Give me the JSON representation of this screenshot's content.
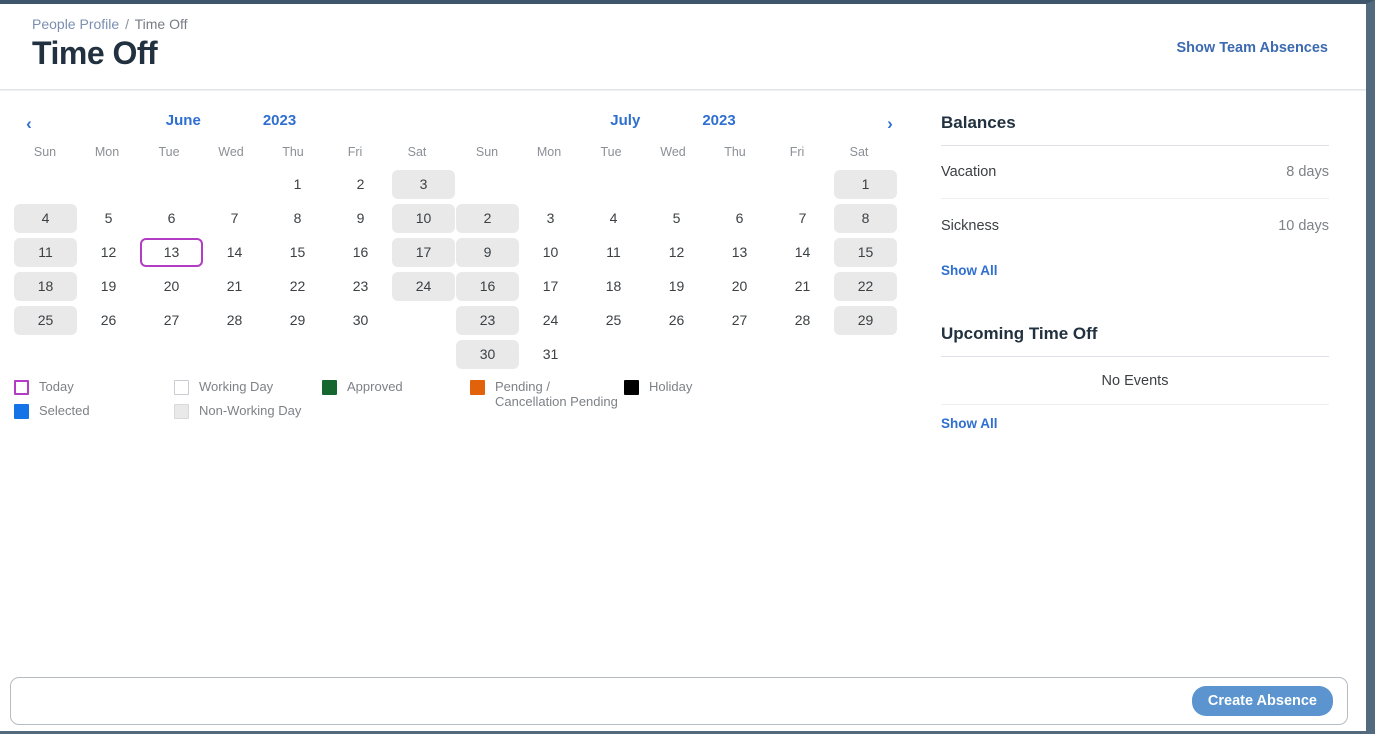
{
  "header": {
    "breadcrumb_parent": "People Profile",
    "breadcrumb_separator": "/",
    "breadcrumb_current": "Time Off",
    "title": "Time Off",
    "action_label": "Show Team Absences"
  },
  "calendar": {
    "prev_icon": "‹",
    "next_icon": "›",
    "weekdays": [
      "Sun",
      "Mon",
      "Tue",
      "Wed",
      "Thu",
      "Fri",
      "Sat"
    ],
    "months": [
      {
        "name": "June",
        "year": "2023",
        "weeks": [
          [
            {
              "label": "",
              "type": "empty"
            },
            {
              "label": "",
              "type": "empty"
            },
            {
              "label": "",
              "type": "empty"
            },
            {
              "label": "",
              "type": "empty"
            },
            {
              "label": "1",
              "type": "working"
            },
            {
              "label": "2",
              "type": "working"
            },
            {
              "label": "3",
              "type": "nonworking"
            }
          ],
          [
            {
              "label": "4",
              "type": "nonworking"
            },
            {
              "label": "5",
              "type": "working"
            },
            {
              "label": "6",
              "type": "working"
            },
            {
              "label": "7",
              "type": "working"
            },
            {
              "label": "8",
              "type": "working"
            },
            {
              "label": "9",
              "type": "working"
            },
            {
              "label": "10",
              "type": "nonworking"
            }
          ],
          [
            {
              "label": "11",
              "type": "nonworking"
            },
            {
              "label": "12",
              "type": "working"
            },
            {
              "label": "13",
              "type": "today"
            },
            {
              "label": "14",
              "type": "working"
            },
            {
              "label": "15",
              "type": "working"
            },
            {
              "label": "16",
              "type": "working"
            },
            {
              "label": "17",
              "type": "nonworking"
            }
          ],
          [
            {
              "label": "18",
              "type": "nonworking"
            },
            {
              "label": "19",
              "type": "working"
            },
            {
              "label": "20",
              "type": "working"
            },
            {
              "label": "21",
              "type": "working"
            },
            {
              "label": "22",
              "type": "working"
            },
            {
              "label": "23",
              "type": "working"
            },
            {
              "label": "24",
              "type": "nonworking"
            }
          ],
          [
            {
              "label": "25",
              "type": "nonworking"
            },
            {
              "label": "26",
              "type": "working"
            },
            {
              "label": "27",
              "type": "working"
            },
            {
              "label": "28",
              "type": "working"
            },
            {
              "label": "29",
              "type": "working"
            },
            {
              "label": "30",
              "type": "working"
            },
            {
              "label": "",
              "type": "empty"
            }
          ],
          [
            {
              "label": "",
              "type": "empty"
            },
            {
              "label": "",
              "type": "empty"
            },
            {
              "label": "",
              "type": "empty"
            },
            {
              "label": "",
              "type": "empty"
            },
            {
              "label": "",
              "type": "empty"
            },
            {
              "label": "",
              "type": "empty"
            },
            {
              "label": "",
              "type": "empty"
            }
          ]
        ]
      },
      {
        "name": "July",
        "year": "2023",
        "weeks": [
          [
            {
              "label": "",
              "type": "empty"
            },
            {
              "label": "",
              "type": "empty"
            },
            {
              "label": "",
              "type": "empty"
            },
            {
              "label": "",
              "type": "empty"
            },
            {
              "label": "",
              "type": "empty"
            },
            {
              "label": "",
              "type": "empty"
            },
            {
              "label": "1",
              "type": "nonworking"
            }
          ],
          [
            {
              "label": "2",
              "type": "nonworking"
            },
            {
              "label": "3",
              "type": "working"
            },
            {
              "label": "4",
              "type": "working"
            },
            {
              "label": "5",
              "type": "working"
            },
            {
              "label": "6",
              "type": "working"
            },
            {
              "label": "7",
              "type": "working"
            },
            {
              "label": "8",
              "type": "nonworking"
            }
          ],
          [
            {
              "label": "9",
              "type": "nonworking"
            },
            {
              "label": "10",
              "type": "working"
            },
            {
              "label": "11",
              "type": "working"
            },
            {
              "label": "12",
              "type": "working"
            },
            {
              "label": "13",
              "type": "working"
            },
            {
              "label": "14",
              "type": "working"
            },
            {
              "label": "15",
              "type": "nonworking"
            }
          ],
          [
            {
              "label": "16",
              "type": "nonworking"
            },
            {
              "label": "17",
              "type": "working"
            },
            {
              "label": "18",
              "type": "working"
            },
            {
              "label": "19",
              "type": "working"
            },
            {
              "label": "20",
              "type": "working"
            },
            {
              "label": "21",
              "type": "working"
            },
            {
              "label": "22",
              "type": "nonworking"
            }
          ],
          [
            {
              "label": "23",
              "type": "nonworking"
            },
            {
              "label": "24",
              "type": "working"
            },
            {
              "label": "25",
              "type": "working"
            },
            {
              "label": "26",
              "type": "working"
            },
            {
              "label": "27",
              "type": "working"
            },
            {
              "label": "28",
              "type": "working"
            },
            {
              "label": "29",
              "type": "nonworking"
            }
          ],
          [
            {
              "label": "30",
              "type": "nonworking"
            },
            {
              "label": "31",
              "type": "working"
            },
            {
              "label": "",
              "type": "empty"
            },
            {
              "label": "",
              "type": "empty"
            },
            {
              "label": "",
              "type": "empty"
            },
            {
              "label": "",
              "type": "empty"
            },
            {
              "label": "",
              "type": "empty"
            }
          ]
        ]
      }
    ]
  },
  "legend": {
    "columns": [
      [
        {
          "label": "Today",
          "swatch": "sw-today",
          "color": "#b23cc4"
        },
        {
          "label": "Selected",
          "swatch": "sw-selected",
          "color": "#1473e6"
        }
      ],
      [
        {
          "label": "Working Day",
          "swatch": "sw-working",
          "color": "#ffffff"
        },
        {
          "label": "Non-Working Day",
          "swatch": "sw-nonworking",
          "color": "#e9e9ea"
        }
      ],
      [
        {
          "label": "Approved",
          "swatch": "sw-approved",
          "color": "#15662f"
        }
      ],
      [
        {
          "label": "Pending / Cancellation Pending",
          "swatch": "sw-pending",
          "color": "#e2620c"
        }
      ],
      [
        {
          "label": "Holiday",
          "swatch": "sw-holiday",
          "color": "#000000"
        }
      ]
    ]
  },
  "balances": {
    "title": "Balances",
    "rows": [
      {
        "name": "Vacation",
        "value": "8 days"
      },
      {
        "name": "Sickness",
        "value": "10 days"
      }
    ],
    "show_all_label": "Show All"
  },
  "upcoming": {
    "title": "Upcoming Time Off",
    "empty_text": "No Events",
    "show_all_label": "Show All"
  },
  "footer": {
    "create_absence_label": "Create Absence"
  }
}
